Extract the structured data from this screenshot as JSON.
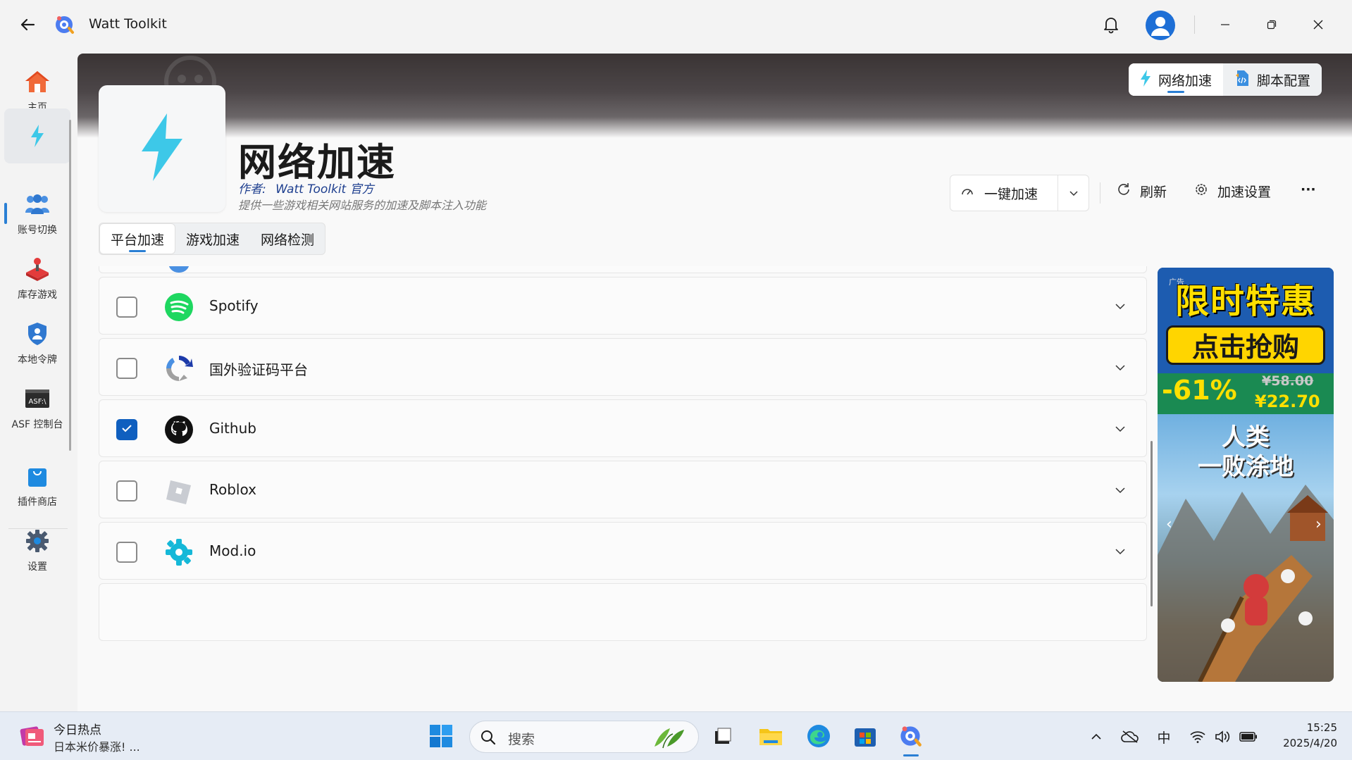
{
  "app": {
    "title": "Watt Toolkit"
  },
  "sidebar": {
    "items": [
      {
        "label": "主页",
        "icon": "home-icon"
      },
      {
        "label": "",
        "icon": "lightning-icon",
        "active": true
      },
      {
        "label": "账号切换",
        "icon": "users-icon"
      },
      {
        "label": "库存游戏",
        "icon": "joystick-icon"
      },
      {
        "label": "本地令牌",
        "icon": "shield-icon"
      },
      {
        "label": "ASF 控制台",
        "icon": "asf-console-icon"
      },
      {
        "label": "插件商店",
        "icon": "store-bag-icon"
      },
      {
        "label": "设置",
        "icon": "gear-icon"
      }
    ]
  },
  "header": {
    "segment": [
      {
        "label": "网络加速",
        "icon": "lightning-icon",
        "active": true
      },
      {
        "label": "脚本配置",
        "icon": "script-icon",
        "active": false
      }
    ],
    "plugin_title": "网络加速",
    "author_prefix": "作者:",
    "author_name": "Watt Toolkit  官方",
    "description": "提供一些游戏相关网站服务的加速及脚本注入功能",
    "one_click_label": "一键加速",
    "refresh_label": "刷新",
    "settings_label": "加速设置",
    "more_label": "···"
  },
  "tabs": [
    {
      "label": "平台加速",
      "active": true
    },
    {
      "label": "游戏加速",
      "active": false
    },
    {
      "label": "网络检测",
      "active": false
    }
  ],
  "services": [
    {
      "name": "Spotify",
      "checked": false,
      "icon": "spotify-icon"
    },
    {
      "name": "国外验证码平台",
      "checked": false,
      "icon": "recaptcha-icon"
    },
    {
      "name": "Github",
      "checked": true,
      "icon": "github-icon"
    },
    {
      "name": "Roblox",
      "checked": false,
      "icon": "roblox-icon"
    },
    {
      "name": "Mod.io",
      "checked": false,
      "icon": "modio-icon"
    }
  ],
  "ad": {
    "tag": "广告",
    "headline": "限时特惠",
    "cta": "点击抢购",
    "discount": "-61%",
    "old_price": "¥58.00",
    "new_price": "¥22.70",
    "game_title_line1": "人类",
    "game_title_line2": "一败涂地"
  },
  "taskbar": {
    "news_title": "今日热点",
    "news_text": "日本米价暴涨! ...",
    "search_placeholder": "搜索",
    "ime": "中",
    "time": "15:25",
    "date": "2025/4/20"
  },
  "colors": {
    "accent": "#2a7fd4",
    "lightning": "#3dc8e8",
    "checkbox_checked": "#0f5fbf",
    "ad_yellow": "#ffe000"
  }
}
